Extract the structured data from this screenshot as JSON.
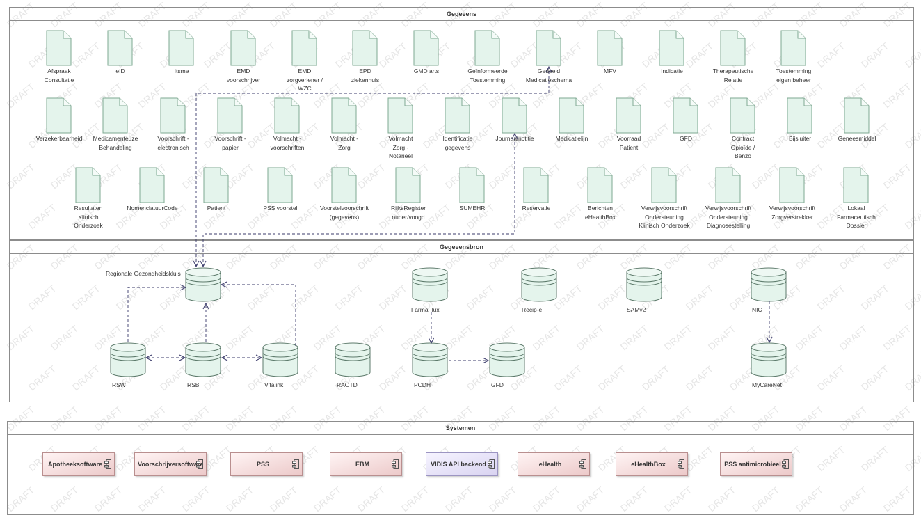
{
  "watermark": "DRAFT",
  "panes": {
    "gegevens": "Gegevens",
    "gegevensbron": "Gegevensbron",
    "systemen": "Systemen"
  },
  "documents": [
    [
      "Afspraak\nConsultatie",
      "eID",
      "Itsme",
      "EMD\nvoorschrijver",
      "EMD\nzorgverlener /\nWZC",
      "EPD\nziekenhuis",
      "GMD arts",
      "Geïnformeerde\nToestemming",
      "Gedeeld\nMedicatieschema",
      "MFV",
      "Indicatie",
      "Therapeutische\nRelatie",
      "Toestemming\neigen beheer"
    ],
    [
      "Verzekerbaarheid",
      "Medicamenteuze\nBehandeling",
      "Voorschrift -\nelectronisch",
      "Voorschrift -\npapier",
      "Volmacht -\nvoorschriften",
      "Volmacht -\nZorg",
      "Volmacht\nZorg -\nNotarieel",
      "Identificatie\ngegevens",
      "Journaalnotitie",
      "Medicatielijn",
      "Voorraad\nPatient",
      "GFD",
      "Contract\nOpioïde /\nBenzo",
      "Bijsluiter",
      "Geneesmiddel"
    ],
    [
      "Resultaten\nKlinisch\nOnderzoek",
      "NomenclatuurCode",
      "Patient",
      "PSS voorstel",
      "Voorstelvoorschrift\n(gegevens)",
      "RijksRegister\nouder/voogd",
      "SUMEHR",
      "Reservatie",
      "Berichten\neHealthBox",
      "Verwijsvoorschrift\nOndersteuning\nKlinisch Onderzoek",
      "Verwijsvoorschrift\nOndersteuning\nDiagnosestelling",
      "Verwijsvoorschrift\nZorgverstrekker",
      "Lokaal\nFarmaceutisch\nDossier"
    ]
  ],
  "databases": [
    "Regionale Gezondheidskluis",
    "FarmaFlux",
    "Recip-e",
    "SAMv2",
    "NIC",
    "RSW",
    "RSB",
    "Vitalink",
    "RAOTD",
    "PCDH",
    "GFD",
    "MyCareNet"
  ],
  "systems": [
    "Apotheeksoftware",
    "Voorschrijversoftware",
    "PSS",
    "EBM",
    "VIDIS API backend",
    "eHealth",
    "eHealthBox",
    "PSS antimicrobieel"
  ],
  "colors": {
    "doc_fill": "#e4f4ec",
    "doc_stroke": "#7ea892",
    "db_fill": "#e4f4ec",
    "db_stroke": "#5d7a6b",
    "component_fill": "#f2d9d9",
    "api_fill": "#e3def7",
    "connector": "#3b3b6b",
    "pane_border": "#8c8c8c"
  }
}
